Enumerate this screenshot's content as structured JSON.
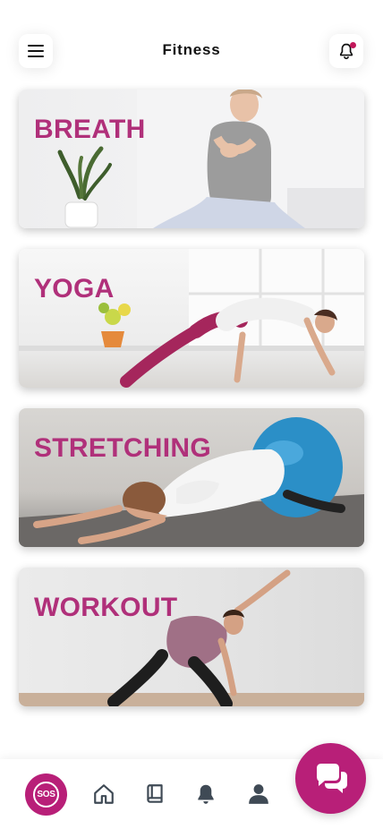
{
  "header": {
    "title": "Fitness",
    "menu_icon": "hamburger-menu-icon",
    "notification_icon": "bell-icon"
  },
  "cards": [
    {
      "label": "BREATH"
    },
    {
      "label": "YOGA"
    },
    {
      "label": "STRETCHING"
    },
    {
      "label": "WORKOUT"
    }
  ],
  "bottom_nav": {
    "sos_label": "SOS",
    "items": [
      "sos-icon",
      "home-icon",
      "book-icon",
      "bell-icon",
      "profile-icon"
    ]
  },
  "chat_fab": {
    "icon": "chat-icon"
  },
  "colors": {
    "accent": "#b81f78",
    "card_label": "#b0307a",
    "notification_dot": "#c2185b"
  }
}
